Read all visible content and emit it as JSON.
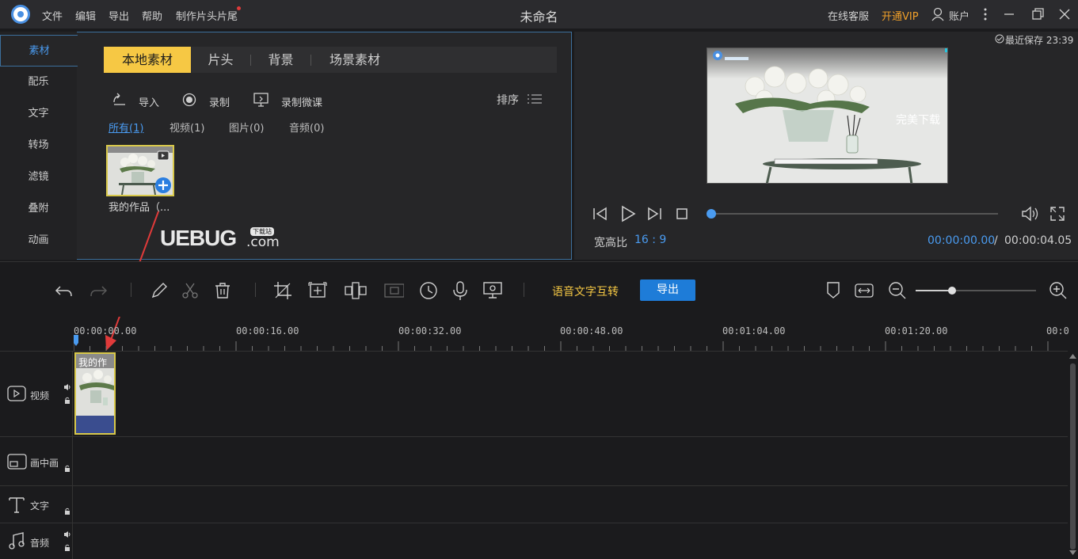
{
  "titlebar": {
    "menus": [
      "文件",
      "编辑",
      "导出",
      "帮助",
      "制作片头片尾"
    ],
    "title": "未命名",
    "service": "在线客服",
    "vip": "开通VIP",
    "account": "账户"
  },
  "side_nav": [
    "素材",
    "配乐",
    "文字",
    "转场",
    "滤镜",
    "叠附",
    "动画"
  ],
  "tabs": [
    "本地素材",
    "片头",
    "背景",
    "场景素材"
  ],
  "media_tools": {
    "import": "导入",
    "record": "录制",
    "record_lesson": "录制微课",
    "sort": "排序"
  },
  "filters": [
    "所有(1)",
    "视频(1)",
    "图片(0)",
    "音频(0)"
  ],
  "media_item": {
    "name": "我的作品（..."
  },
  "watermark": {
    "text": "UEBUG",
    "suffix": ".com",
    "tag": "下载站"
  },
  "preview": {
    "saved": "最近保存 23:39",
    "overlay_text": "完美下载",
    "aspect_label": "宽高比",
    "aspect_value": "16 : 9",
    "current_time": "00:00:00.00",
    "separator": "/",
    "total_time": "00:00:04.05",
    "progress": 0.0
  },
  "toolbar": {
    "speech_text": "语音文字互转",
    "export": "导出",
    "zoom_level": 0.3
  },
  "ruler": [
    "00:00:00.00",
    "00:00:16.00",
    "00:00:32.00",
    "00:00:48.00",
    "00:01:04.00",
    "00:01:20.00",
    "00:0"
  ],
  "tracks": [
    "视频",
    "画中画",
    "文字",
    "音频"
  ],
  "clip": {
    "label": "我的作"
  },
  "colors": {
    "accent_blue": "#1e7cd8",
    "tab_yellow": "#f6c844",
    "vip_orange": "#f0a02a",
    "select_yellow": "#d8c84a",
    "arrow_red": "#e03a3a"
  }
}
